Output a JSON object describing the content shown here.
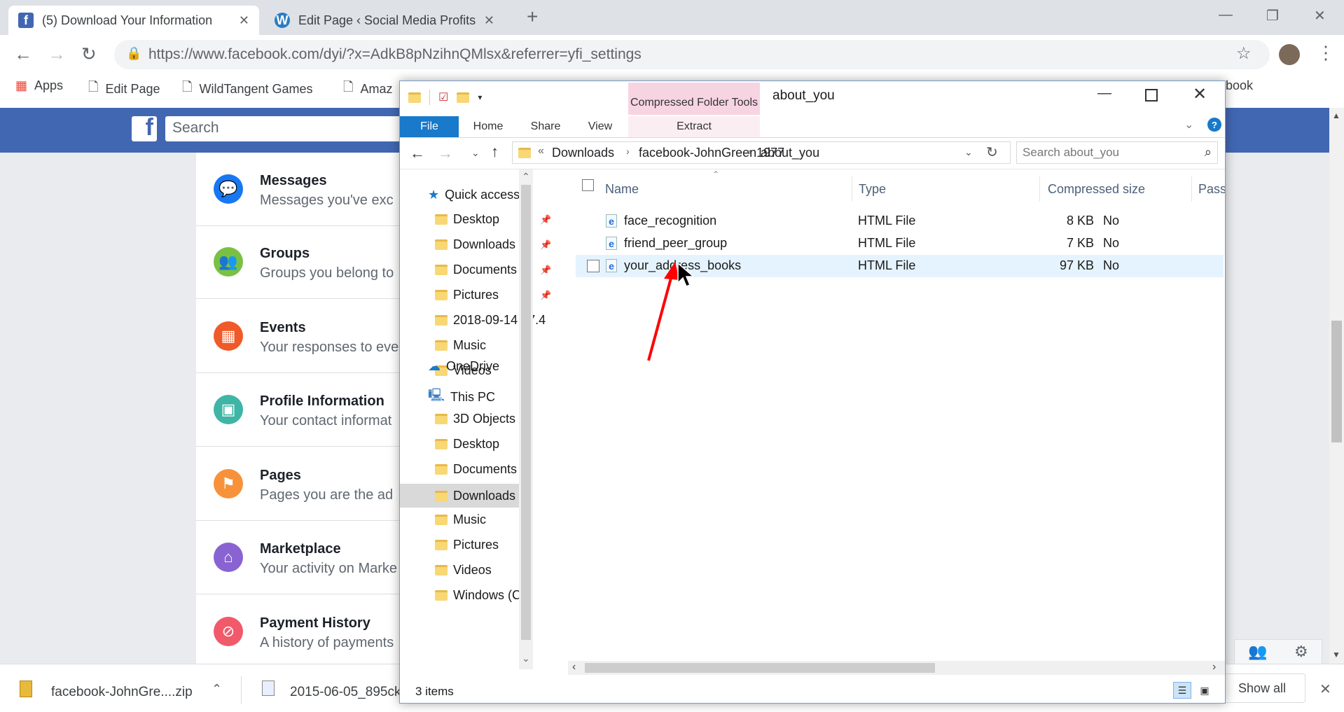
{
  "browser": {
    "tabs": [
      {
        "title": "(5) Download Your Information",
        "favicon": "facebook-icon"
      },
      {
        "title": "Edit Page ‹ Social Media Profits",
        "favicon": "wordpress-icon"
      }
    ],
    "url": "https://www.facebook.com/dyi/?x=AdkB8pNzihnQMlsx&referrer=yfi_settings",
    "bookmarks": [
      "Apps",
      "Edit Page",
      "WildTangent Games",
      "Amaz",
      "book"
    ]
  },
  "facebook": {
    "search_placeholder": "Search",
    "items": [
      {
        "title": "Messages",
        "subtitle": "Messages you've exc",
        "color": "#1877f2",
        "icon": "messenger-icon"
      },
      {
        "title": "Groups",
        "subtitle": "Groups you belong to",
        "color": "#7ac143",
        "icon": "groups-icon"
      },
      {
        "title": "Events",
        "subtitle": "Your responses to eve",
        "color": "#f05a28",
        "icon": "calendar-icon"
      },
      {
        "title": "Profile Information",
        "subtitle": "Your contact informat",
        "color": "#3fb5a5",
        "icon": "profile-card-icon"
      },
      {
        "title": "Pages",
        "subtitle": "Pages you are the ad",
        "color": "#f7923a",
        "icon": "flag-icon"
      },
      {
        "title": "Marketplace",
        "subtitle": "Your activity on Marke",
        "color": "#8a63d2",
        "icon": "store-icon"
      },
      {
        "title": "Payment History",
        "subtitle": "A history of payments",
        "color": "#f05a6a",
        "icon": "payment-icon"
      }
    ]
  },
  "explorer": {
    "title": "about_you",
    "ribbon_context": "Compressed Folder Tools",
    "ribbon_tabs": [
      "File",
      "Home",
      "Share",
      "View",
      "Extract"
    ],
    "breadcrumb": [
      "Downloads",
      "facebook-JohnGreen1977",
      "about_you"
    ],
    "search_placeholder": "Search about_you",
    "nav": {
      "quick_access": "Quick access",
      "quick_items": [
        "Desktop",
        "Downloads",
        "Documents",
        "Pictures",
        "2018-09-14 17.4",
        "Music",
        "Videos"
      ],
      "onedrive": "OneDrive",
      "this_pc": "This PC",
      "pc_items": [
        "3D Objects",
        "Desktop",
        "Documents",
        "Downloads",
        "Music",
        "Pictures",
        "Videos",
        "Windows (C:)"
      ]
    },
    "columns": [
      "Name",
      "Type",
      "Compressed size",
      "Passw"
    ],
    "files": [
      {
        "name": "face_recognition",
        "type": "HTML File",
        "size": "8 KB",
        "pw": "No"
      },
      {
        "name": "friend_peer_group",
        "type": "HTML File",
        "size": "7 KB",
        "pw": "No"
      },
      {
        "name": "your_address_books",
        "type": "HTML File",
        "size": "97 KB",
        "pw": "No"
      }
    ],
    "status": "3 items"
  },
  "downloads": {
    "items": [
      "facebook-JohnGre....zip",
      "2015-06-05_895ck"
    ],
    "show_all": "Show all"
  },
  "colors": {
    "facebook_blue": "#4267b2",
    "explorer_selection": "#e5f3ff",
    "file_tab": "#1979ca",
    "annotation_arrow": "#ff0000"
  }
}
